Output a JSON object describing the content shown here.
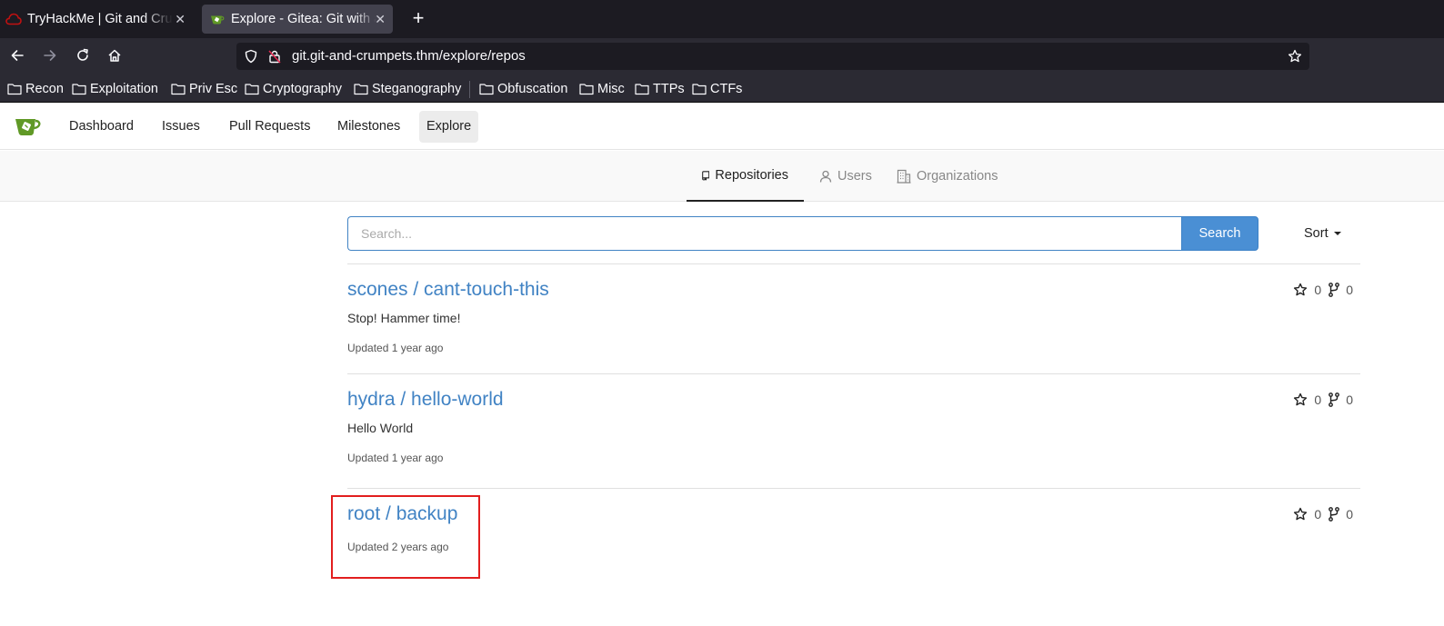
{
  "browser": {
    "tabs": [
      {
        "title": "TryHackMe | Git and Crumpets",
        "active": false,
        "favicon": "tryhackme-cloud-icon",
        "close": "✕"
      },
      {
        "title": "Explore - Gitea: Git with a cup of tea",
        "active": true,
        "favicon": "gitea-icon",
        "close": "✕"
      }
    ],
    "new_tab": "+",
    "url": "git.git-and-crumpets.thm/explore/repos",
    "bookmarks": [
      "Recon",
      "Exploitation",
      "Priv Esc",
      "Cryptography",
      "Steganography",
      "Obfuscation",
      "Misc",
      "TTPs",
      "CTFs"
    ]
  },
  "gitea": {
    "nav": [
      "Dashboard",
      "Issues",
      "Pull Requests",
      "Milestones",
      "Explore"
    ],
    "active_nav": "Explore",
    "subtabs": [
      "Repositories",
      "Users",
      "Organizations"
    ],
    "active_subtab": "Repositories",
    "search": {
      "placeholder": "Search...",
      "button": "Search"
    },
    "sort": "Sort",
    "repos": [
      {
        "title": "scones / cant-touch-this",
        "description": "Stop! Hammer time!",
        "updated": "Updated 1 year ago",
        "stars": "0",
        "forks": "0"
      },
      {
        "title": "hydra / hello-world",
        "description": "Hello World",
        "updated": "Updated 1 year ago",
        "stars": "0",
        "forks": "0"
      },
      {
        "title": "root / backup",
        "description": "",
        "updated": "Updated 2 years ago",
        "stars": "0",
        "forks": "0"
      }
    ]
  },
  "colors": {
    "link": "#4183c4",
    "search_button": "#4a8fd4",
    "highlight_box": "#e21e1e",
    "tab_bar": "#1c1b22",
    "toolbar": "#2b2a33"
  }
}
